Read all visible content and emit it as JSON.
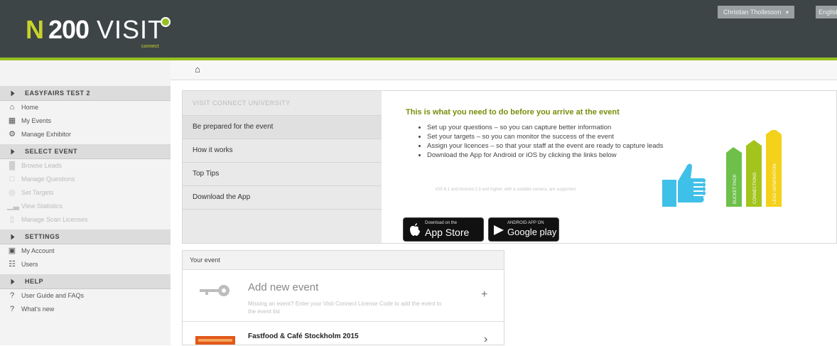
{
  "header": {
    "logo_n": "N",
    "logo_200": "200",
    "logo_visit": "VISIT",
    "logo_sub": "connect",
    "user_name": "Christian Thollesson",
    "language": "English"
  },
  "sidebar": {
    "sections": [
      {
        "title": "EASYFAIRS TEST 2",
        "items": [
          {
            "label": "Home",
            "icon": "home-icon"
          },
          {
            "label": "My Events",
            "icon": "calendar-icon"
          },
          {
            "label": "Manage Exhibitor",
            "icon": "settings-icon"
          }
        ]
      },
      {
        "title": "SELECT EVENT",
        "items": [
          {
            "label": "Browse Leads",
            "icon": "bar-chart-icon"
          },
          {
            "label": "Manage Questions",
            "icon": "document-icon"
          },
          {
            "label": "Set Targets",
            "icon": "target-icon"
          },
          {
            "label": "View Statistics",
            "icon": "stats-icon"
          },
          {
            "label": "Manage Scan Licenses",
            "icon": "phone-icon"
          }
        ]
      },
      {
        "title": "SETTINGS",
        "items": [
          {
            "label": "My Account",
            "icon": "account-icon"
          },
          {
            "label": "Users",
            "icon": "users-icon"
          }
        ]
      },
      {
        "title": "HELP",
        "items": [
          {
            "label": "User Guide and FAQs",
            "icon": "question-icon"
          },
          {
            "label": "What's new",
            "icon": "question-icon"
          }
        ]
      }
    ]
  },
  "university": {
    "title": "VISIT CONNECT UNIVERSITY",
    "tabs": [
      "Be prepared for the event",
      "How it works",
      "Top Tips",
      "Download the App"
    ],
    "heading": "This is what you need to do before you arrive at the event",
    "bullets": [
      "Set up your questions – so you can capture better information",
      "Set your targets – so you can monitor the success of the event",
      "Assign your licences – so that your staff at the event are ready to capture leads",
      "Download the App for Android or iOS by clicking the links below"
    ],
    "small_note": "iOS 8.1 and Android 2.3 and higher, with a suitable camera, are supported",
    "appstore": {
      "small": "Download on the",
      "big": "App Store"
    },
    "googleplay": {
      "small": "ANDROID APP ON",
      "big": "Google play"
    },
    "bars": [
      "BUCKET PACK",
      "CONNECTIONS",
      "LEAD GENERATION"
    ]
  },
  "your_event": {
    "header": "Your event",
    "add_title": "Add new event",
    "add_desc": "Missing an event? Enter your Visit Connect License Code to add the event to the event list",
    "event_name": "Fastfood & Café Stockholm 2015"
  },
  "colors": {
    "header_bg": "#3e4546",
    "accent_green": "#95c11f",
    "logo_yellow": "#c7d32b",
    "heading_green": "#7a8c0a",
    "thumb_blue": "#3fc0e8"
  }
}
